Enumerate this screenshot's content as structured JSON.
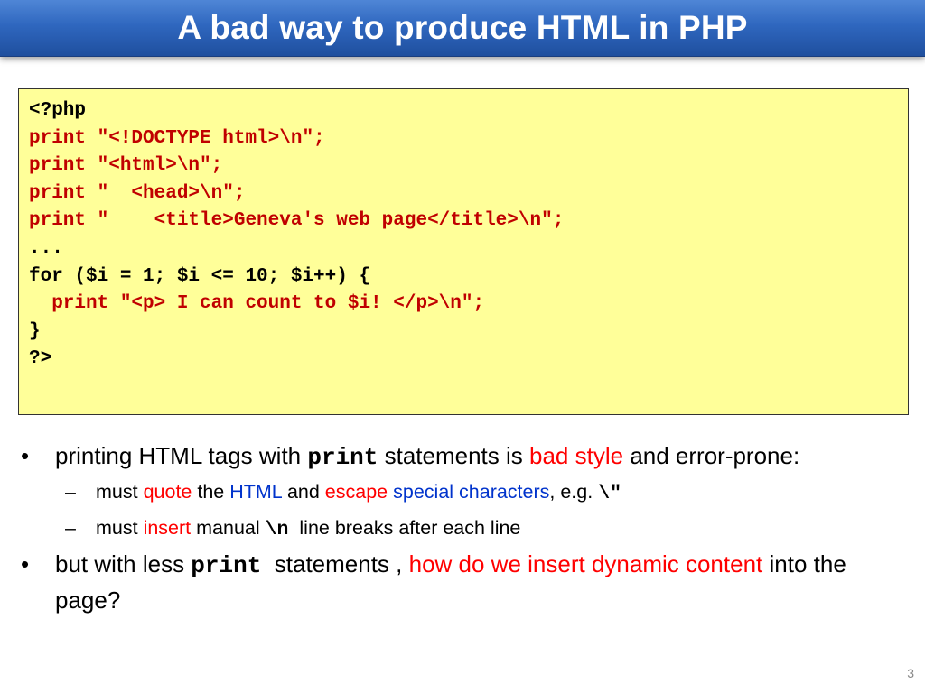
{
  "title": "A bad way to produce HTML in PHP",
  "code": {
    "line1": "<?php",
    "line2": "print \"<!DOCTYPE html>\\n\";",
    "line3": "print \"<html>\\n\";",
    "line4": "print \"  <head>\\n\";",
    "line5": "print \"    <title>Geneva's web page</title>\\n\";",
    "line6": "...",
    "line7": "for ($i = 1; $i <= 10; $i++) {",
    "line8": "  print \"<p> I can count to $i! </p>\\n\";",
    "line9": "}",
    "line10": "?>"
  },
  "bullets": {
    "b1": {
      "bullet": "•",
      "t1": "printing HTML tags with ",
      "code": "print",
      "t2": " statements is ",
      "highlight": "bad style",
      "t3": " and error-prone:"
    },
    "s1": {
      "dash": "–",
      "t1": "must ",
      "quote": "quote",
      "t2": " the ",
      "html": "HTML",
      "t3": " and ",
      "escape": "escape",
      "t4": " ",
      "special": "special characters",
      "t5": ", e.g. ",
      "code": "\\\"",
      "t6": ""
    },
    "s2": {
      "dash": "–",
      "t1": "must ",
      "insert": "insert",
      "t2": " manual ",
      "code": "\\n",
      "t3": "  line breaks after each line"
    },
    "b2": {
      "bullet": "•",
      "t1": "but with less ",
      "code": "print",
      "t2": "  statements , ",
      "highlight": "how do we insert dynamic content",
      "t3": " into the page?"
    }
  },
  "page_number": "3",
  "colors": {
    "title_bar": "#2f67bf",
    "code_background": "#ffff99",
    "code_accent": "#c00000",
    "highlight_red": "#ff0000",
    "highlight_blue": "#0033cc"
  }
}
